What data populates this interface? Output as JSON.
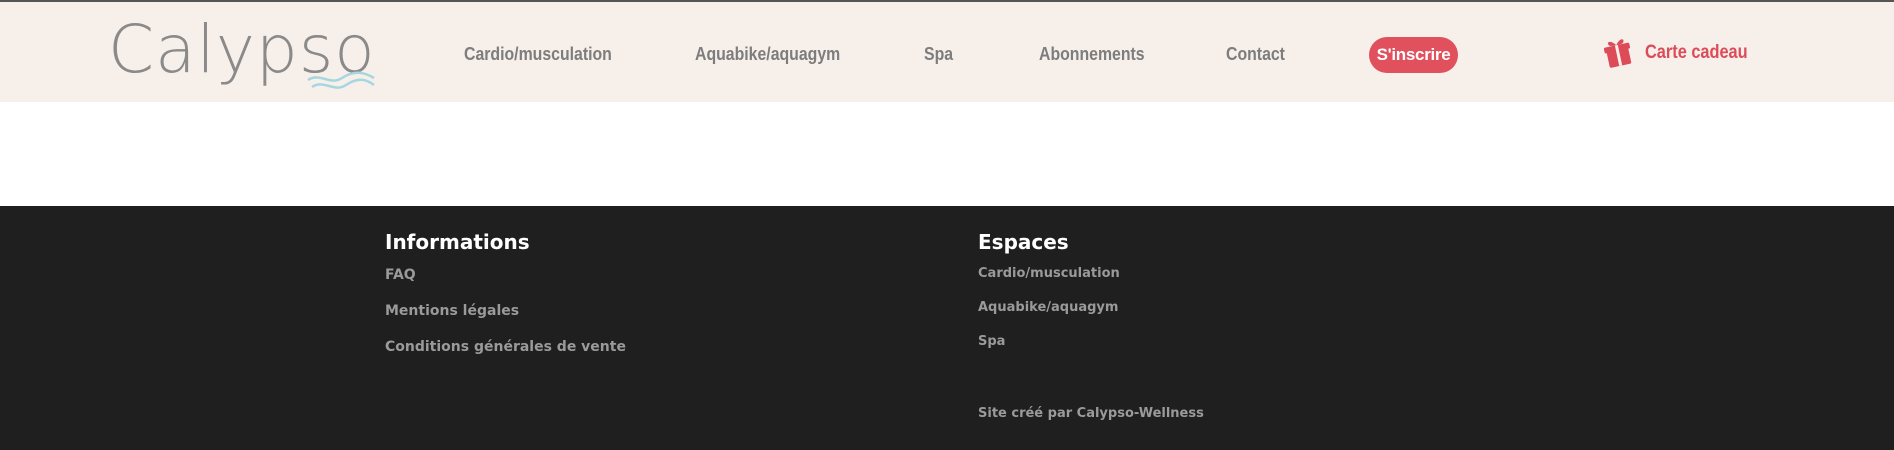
{
  "brand": {
    "logo_text": "Calypso"
  },
  "nav": {
    "items": [
      {
        "label": "Cardio/musculation"
      },
      {
        "label": "Aquabike/aquagym"
      },
      {
        "label": "Spa"
      },
      {
        "label": "Abonnements"
      },
      {
        "label": "Contact"
      }
    ],
    "signup_label": "S'inscrire",
    "gift_label": "Carte cadeau",
    "gift_icon": "gift-icon"
  },
  "footer": {
    "informations": {
      "title": "Informations",
      "links": [
        "FAQ",
        "Mentions légales",
        "Conditions générales de vente"
      ]
    },
    "espaces": {
      "title": "Espaces",
      "links": [
        "Cardio/musculation",
        "Aquabike/aquagym",
        "Spa"
      ]
    },
    "credit": "Site créé par Calypso-Wellness"
  },
  "colors": {
    "header_bg": "#f7efea",
    "accent": "#e0505d",
    "nav_text": "#7d7d7d",
    "footer_bg": "#1f1f1f",
    "footer_text": "#9a9a9a"
  }
}
